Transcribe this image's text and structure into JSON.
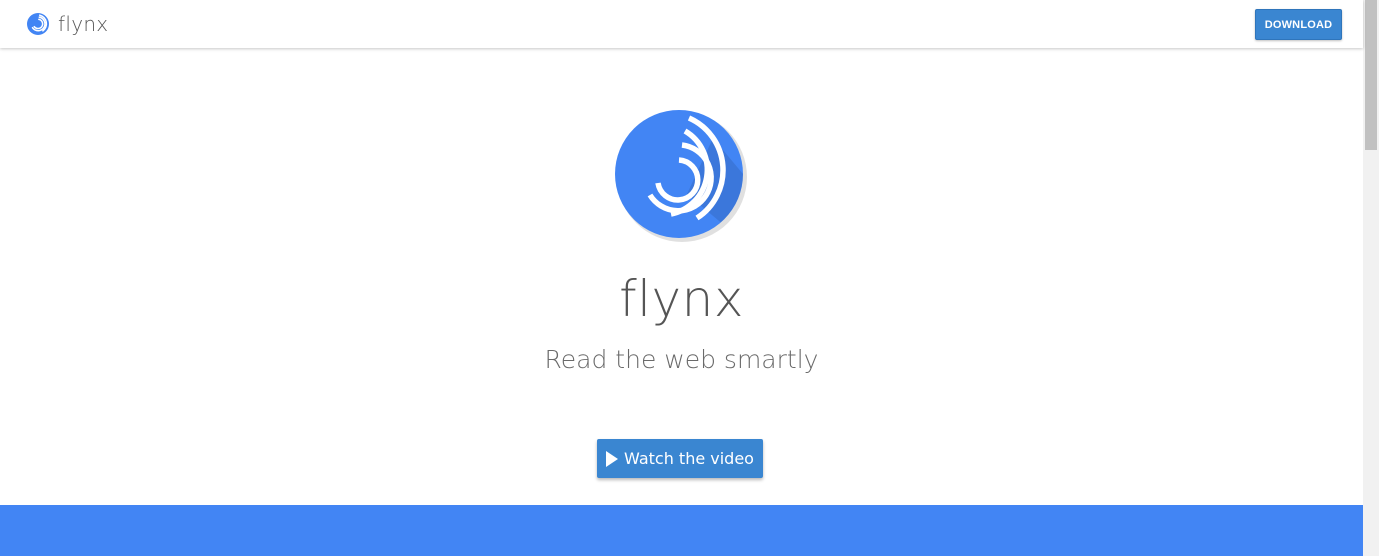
{
  "navbar": {
    "brand_name": "flynx",
    "download_label": "DOWNLOAD"
  },
  "hero": {
    "title": "flynx",
    "tagline": "Read the web smartly",
    "video_button_label": "Watch the video",
    "video_button_icon": "play-icon",
    "logo_icon": "flynx-logo-icon"
  },
  "colors": {
    "brand_blue": "#4285f4",
    "button_blue": "#3a86d1",
    "text_gray": "#555555"
  }
}
